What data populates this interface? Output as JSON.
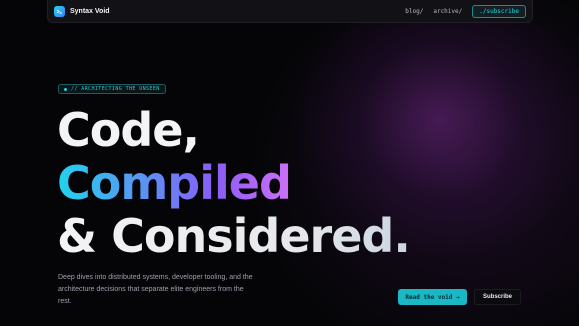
{
  "nav": {
    "brand": "Syntax Void",
    "links": [
      "blog/",
      "archive/"
    ],
    "cta": "./subscribe"
  },
  "hero": {
    "tag": "// ARCHITECTING THE UNSEEN",
    "headline": {
      "line1": "Code,",
      "line2": "Compiled",
      "line3": "& Considered."
    },
    "description": "Deep dives into distributed systems, developer tooling, and the architecture decisions that separate elite engineers from the rest.",
    "primary_button": "Read the void →",
    "secondary_button": "Subscribe"
  },
  "colors": {
    "accent": "#19b8c4",
    "background": "#050507",
    "gradient": [
      "#22d3ee",
      "#8b5cf6",
      "#e879f9"
    ]
  },
  "icons": {
    "logo": "brand-logo-icon",
    "tag_dot": "status-dot-icon"
  }
}
